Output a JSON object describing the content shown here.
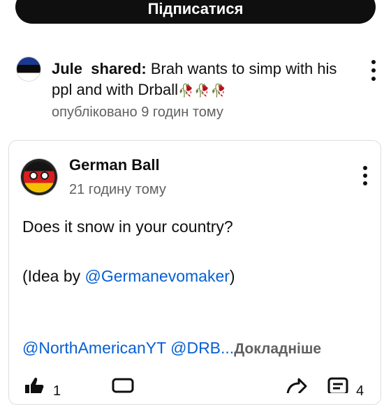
{
  "subscribe": {
    "label": "Підписатися"
  },
  "shared_post": {
    "author": "Jule",
    "action": "shared:",
    "text": "Brah wants to simp with his ppl and with Drball",
    "roses": "🥀🥀🥀",
    "time": "опубліковано 9 годин тому",
    "avatar_icon": "flag-avatar-icon"
  },
  "post": {
    "author": "German Ball",
    "time": "21 годину тому",
    "line1": "Does it snow in your country?",
    "idea_prefix": "(Idea by ",
    "idea_link": "@Germanevomaker",
    "idea_suffix": ")",
    "mention1": "@NorthAmericanYT",
    "mention2": "@DRB",
    "ellipsis": "...",
    "more_label": "Докладніше"
  },
  "actions": {
    "like_count": "1",
    "save_count": "4"
  },
  "colors": {
    "link": "#065fd4",
    "secondary_text": "#606060",
    "subscribe_bg": "#0f0f0f"
  }
}
